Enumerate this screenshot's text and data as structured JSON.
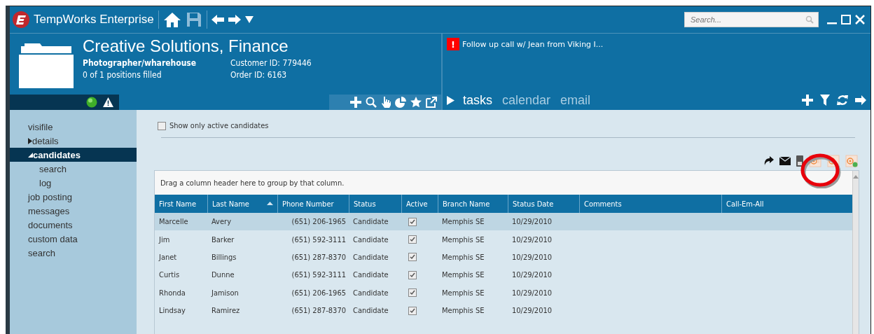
{
  "app": {
    "title": "TempWorks Enterprise",
    "search": {
      "placeholder": "Search..."
    }
  },
  "record": {
    "title": "Creative Solutions, Finance",
    "position": "Photographer/wharehouse",
    "filled": "0 of 1 positions filled",
    "customer_id": "Customer ID: 779446",
    "order_id": "Order ID: 6163"
  },
  "alerts": [
    {
      "icon": "!",
      "text": "Follow up call w/ Jean from Viking I..."
    }
  ],
  "tabs": [
    {
      "label": "tasks",
      "selected": true
    },
    {
      "label": "calendar",
      "selected": false
    },
    {
      "label": "email",
      "selected": false
    }
  ],
  "sidebar": {
    "items": [
      {
        "label": "visifile",
        "selected": false
      },
      {
        "label": "details",
        "selected": false,
        "expanded": false
      },
      {
        "label": "candidates",
        "selected": true,
        "expanded": true,
        "children": [
          {
            "label": "search",
            "selected": false
          },
          {
            "label": "log",
            "selected": false
          }
        ]
      },
      {
        "label": "job posting",
        "selected": false
      },
      {
        "label": "messages",
        "selected": false
      },
      {
        "label": "documents",
        "selected": false
      },
      {
        "label": "custom data",
        "selected": false
      },
      {
        "label": "search",
        "selected": false
      }
    ]
  },
  "filter": {
    "label": "Show only active candidates",
    "checked": false
  },
  "grid": {
    "group_hint": "Drag a column header here to group by that column.",
    "columns": [
      {
        "label": "First Name",
        "sorted": false
      },
      {
        "label": "Last Name",
        "sorted": true
      },
      {
        "label": "Phone Number",
        "sorted": false
      },
      {
        "label": "Status",
        "sorted": false
      },
      {
        "label": "Active",
        "sorted": false
      },
      {
        "label": "Branch Name",
        "sorted": false
      },
      {
        "label": "Status Date",
        "sorted": false
      },
      {
        "label": "Comments",
        "sorted": false
      },
      {
        "label": "Call-Em-All",
        "sorted": false
      }
    ],
    "rows": [
      {
        "first": "Marcelle",
        "last": "Avery",
        "phone": "(651) 206-1965",
        "status": "Candidate",
        "active": true,
        "branch": "Memphis SE",
        "date": "10/29/2010",
        "selected": true
      },
      {
        "first": "Jim",
        "last": "Barker",
        "phone": "(651) 592-3111",
        "status": "Candidate",
        "active": true,
        "branch": "Memphis SE",
        "date": "10/29/2010",
        "selected": false
      },
      {
        "first": "Janet",
        "last": "Billings",
        "phone": "(651) 287-8370",
        "status": "Candidate",
        "active": true,
        "branch": "Memphis SE",
        "date": "10/29/2010",
        "selected": false
      },
      {
        "first": "Curtis",
        "last": "Dunne",
        "phone": "(651) 592-3111",
        "status": "Candidate",
        "active": true,
        "branch": "Memphis SE",
        "date": "10/29/2010",
        "selected": false
      },
      {
        "first": "Rhonda",
        "last": "Jamison",
        "phone": "(651) 206-1965",
        "status": "Candidate",
        "active": true,
        "branch": "Memphis SE",
        "date": "10/29/2010",
        "selected": false
      },
      {
        "first": "Lindsay",
        "last": "Ramirez",
        "phone": "(651) 287-8370",
        "status": "Candidate",
        "active": true,
        "branch": "Memphis SE",
        "date": "10/29/2010",
        "selected": false
      }
    ]
  }
}
